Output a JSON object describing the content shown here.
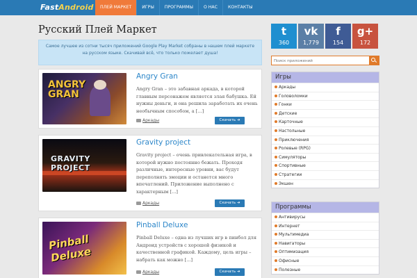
{
  "header": {
    "logo_main": "Fast",
    "logo_accent": "Android",
    "nav": [
      "ПЛЕЙ МАРКЕТ",
      "ИГРЫ",
      "ПРОГРАММЫ",
      "О НАС",
      "КОНТАКТЫ"
    ]
  },
  "main": {
    "title": "Русский Плей Маркет",
    "intro": "Самое лучшее из сотни тысяч приложений Google Play Market собраны в нашем плей маркете на русском языке. Скачивай всё, что только пожелает душа!",
    "posts": [
      {
        "title": "Angry Gran",
        "art": "ANGRY GRAN",
        "desc": "Angry Gran – это забавная аркада, в которой главным персонажем является злая бабушка. Ей нужны деньги, и она решила заработать их очень необычным способом, а [...]",
        "category": "Аркады",
        "button": "Скачать"
      },
      {
        "title": "Gravity project",
        "art": "GRAVITY PROJECT",
        "desc": "Gravity project – очень привлекательная игра, в которой нужно постоянно бежать. Проходя различные, интересные уровни, вас будут переполнять эмоции и останется много впечатлений. Приложение выполнено с характерным [...]",
        "category": "Аркады",
        "button": "Скачать"
      },
      {
        "title": "Pinball Deluxe",
        "art": "Pinball Deluxe",
        "desc": "Pinball Deluxe – одна из лучших игр в пинбол для Андроид устройств с хорошей физикой и качественной графикой. Каждому, цель игры – набрать как можно [...]",
        "category": "Аркады",
        "button": "Скачать"
      }
    ]
  },
  "sidebar": {
    "social": [
      {
        "icon": "twitter-icon",
        "glyph": "t",
        "count": "360",
        "color": "#1f8fd0"
      },
      {
        "icon": "vk-icon",
        "glyph": "vk",
        "count": "1,779",
        "color": "#5b7fa6"
      },
      {
        "icon": "facebook-icon",
        "glyph": "f",
        "count": "154",
        "color": "#3f5b95"
      },
      {
        "icon": "google-plus-icon",
        "glyph": "g+",
        "count": "172",
        "color": "#c8533f"
      }
    ],
    "search_placeholder": "Поиск приложений",
    "games": {
      "title": "Игры",
      "items": [
        "Аркады",
        "Головоломки",
        "Гонки",
        "Детские",
        "Карточные",
        "Настольные",
        "Приключения",
        "Ролевые (RPG)",
        "Симуляторы",
        "Спортивные",
        "Стратегии",
        "Экшен"
      ]
    },
    "programs": {
      "title": "Программы",
      "items": [
        "Антивирусы",
        "Интернет",
        "Мультимедиа",
        "Навигаторы",
        "Оптимизация",
        "Офисные",
        "Полезные"
      ]
    }
  },
  "colors": {
    "nav_bg": "#2a7ab5",
    "nav_active": "#f07a3a",
    "link": "#2c86c9",
    "sidebar_head": "#b5b6e6",
    "accent": "#e07a2a"
  }
}
